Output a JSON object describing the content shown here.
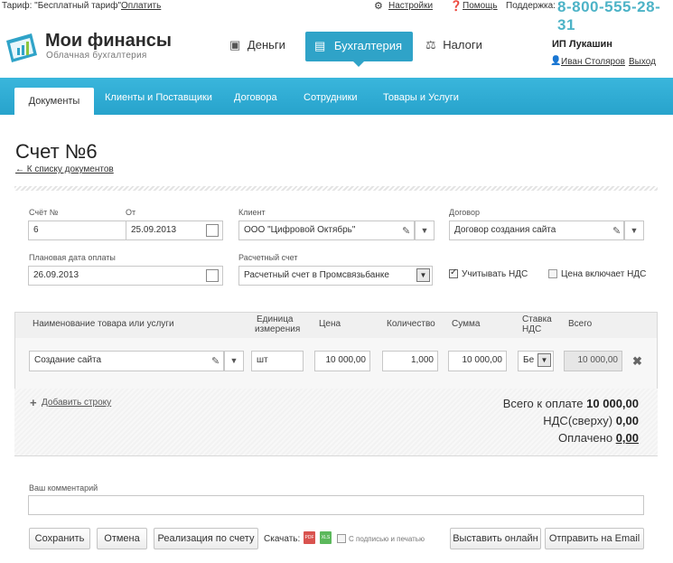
{
  "topbar": {
    "tariff": "Тариф: \"Бесплатный тариф\"",
    "pay_link": "Оплатить",
    "settings": "Настройки",
    "help": "Помощь",
    "support_label": "Поддержка:",
    "phone": "8-800-555-28-31"
  },
  "brand": {
    "title": "Мои финансы",
    "subtitle": "Облачная бухгалтерия"
  },
  "mainnav": {
    "money": "Деньги",
    "accounting": "Бухгалтерия",
    "taxes": "Налоги"
  },
  "user": {
    "company": "ИП Лукашин",
    "name": "Иван Столяров",
    "logout": "Выход"
  },
  "tabs": [
    "Документы",
    "Клиенты и Поставщики",
    "Договора",
    "Сотрудники",
    "Товары и Услуги"
  ],
  "page": {
    "title": "Счет №6",
    "back": "← К списку документов"
  },
  "form": {
    "number_label": "Счёт №",
    "number": "6",
    "date_label": "От",
    "date": "25.09.2013",
    "client_label": "Клиент",
    "client": "ООО \"Цифровой Октябрь\"",
    "contract_label": "Договор",
    "contract": "Договор создания сайта",
    "pay_date_label": "Плановая дата оплаты",
    "pay_date": "26.09.2013",
    "account_label": "Расчетный счет",
    "account": "Расчетный счет в Промсвязьбанке",
    "vat_check": "Учитывать НДС",
    "vat_included": "Цена включает НДС"
  },
  "table": {
    "headers": {
      "name": "Наименование товара или услуги",
      "unit_1": "Единица",
      "unit_2": "измерения",
      "price": "Цена",
      "qty": "Количество",
      "sum": "Сумма",
      "rate_1": "Ставка",
      "rate_2": "НДС",
      "total": "Всего"
    },
    "row": {
      "name": "Создание сайта",
      "unit": "шт",
      "price": "10 000,00",
      "qty": "1,000",
      "sum": "10 000,00",
      "rate": "Бе",
      "total": "10 000,00"
    },
    "add_row": "Добавить строку",
    "total_label": "Всего к оплате",
    "total_value": "10 000,00",
    "vat_label": "НДС(сверху)",
    "vat_value": "0,00",
    "paid_label": "Оплачено",
    "paid_value": "0,00"
  },
  "comment": {
    "label": "Ваш комментарий",
    "value": ""
  },
  "actions": {
    "save": "Сохранить",
    "cancel": "Отмена",
    "realization": "Реализация по счету",
    "download": "Скачать:",
    "with_sign": "С подписью и печатью",
    "publish": "Выставить онлайн",
    "email": "Отправить на Email"
  },
  "colors": {
    "accent": "#2fa3c8",
    "phone": "#4db3c7"
  }
}
